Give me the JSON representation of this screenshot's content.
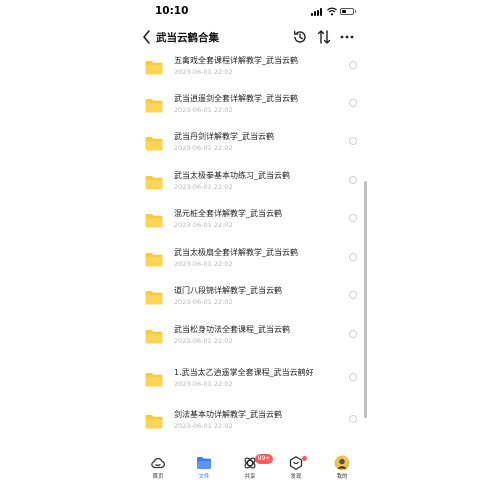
{
  "status_bar": {
    "time": "10:10"
  },
  "header": {
    "title": "武当云鹤合集"
  },
  "files": [
    {
      "name": "五禽戏全套课程详解教学_武当云鹤",
      "date": "2023-06-01 22:02"
    },
    {
      "name": "武当逍遥剑全套详解教学_武当云鹤",
      "date": "2023-06-01 22:02"
    },
    {
      "name": "武当丹剑详解教学_武当云鹤",
      "date": "2023-06-01 22:02"
    },
    {
      "name": "武当太极拳基本功练习_武当云鹤",
      "date": "2023-06-01 22:02"
    },
    {
      "name": "混元桩全套详解教学_武当云鹤",
      "date": "2023-06-01 22:02"
    },
    {
      "name": "武当太极扇全套详解教学_武当云鹤",
      "date": "2023-06-01 22:02"
    },
    {
      "name": "道门八段锦详解教学_武当云鹤",
      "date": "2023-06-01 22:02"
    },
    {
      "name": "武当松身功法全套课程_武当云鹤",
      "date": "2023-06-01 22:02"
    },
    {
      "name": "1.武当太乙逍遥掌全套课程_武当云鹤好",
      "date": "2023-06-01 22:02"
    },
    {
      "name": "剑法基本功详解教学_武当云鹤",
      "date": "2023-06-01 22:02"
    }
  ],
  "tabs": [
    {
      "label": "首页",
      "icon": "cloud-home-icon"
    },
    {
      "label": "文件",
      "icon": "folder-icon",
      "active": true
    },
    {
      "label": "共享",
      "icon": "share-icon"
    },
    {
      "label": "发现",
      "icon": "discover-icon"
    },
    {
      "label": "我的",
      "icon": "avatar-icon"
    }
  ],
  "share_badge": "99+",
  "colors": {
    "accent": "#3b7cf4",
    "folder": "#f9c93e",
    "badge": "#f65c5c"
  }
}
